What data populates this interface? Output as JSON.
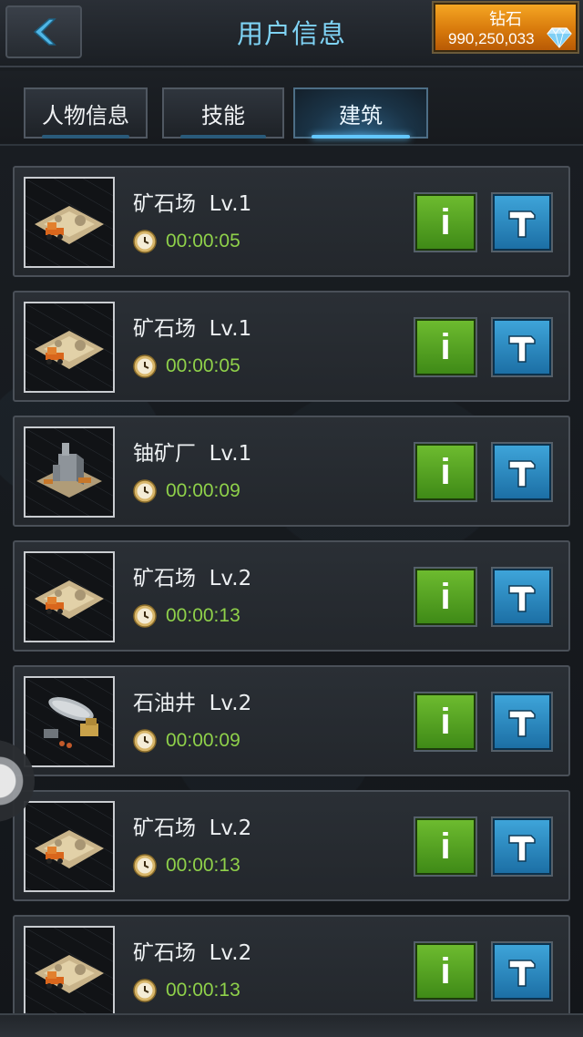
{
  "header": {
    "title": "用户信息",
    "currency_label": "钻石",
    "currency_value": "990,250,033"
  },
  "tabs": [
    {
      "label": "人物信息",
      "active": false
    },
    {
      "label": "技能",
      "active": false
    },
    {
      "label": "建筑",
      "active": true
    }
  ],
  "buildings": [
    {
      "name": "矿石场  Lv.1",
      "timer": "00:00:05",
      "type": "ore-field"
    },
    {
      "name": "矿石场  Lv.1",
      "timer": "00:00:05",
      "type": "ore-field"
    },
    {
      "name": "铀矿厂  Lv.1",
      "timer": "00:00:09",
      "type": "uranium-plant"
    },
    {
      "name": "矿石场  Lv.2",
      "timer": "00:00:13",
      "type": "ore-field"
    },
    {
      "name": "石油井  Lv.2",
      "timer": "00:00:09",
      "type": "oil-well"
    },
    {
      "name": "矿石场  Lv.2",
      "timer": "00:00:13",
      "type": "ore-field"
    },
    {
      "name": "矿石场  Lv.2",
      "timer": "00:00:13",
      "type": "ore-field"
    }
  ],
  "buttons": {
    "info_label": "i"
  },
  "colors": {
    "title": "#7fd3f5",
    "timer": "#8fd14a",
    "info_button": "#4f9e20",
    "build_button": "#2583bd",
    "currency_box": "#e58d17"
  }
}
